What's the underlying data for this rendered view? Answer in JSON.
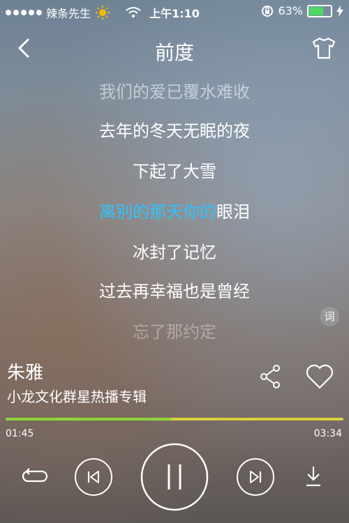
{
  "status": {
    "carrier": "辣条先生",
    "time": "上午1:10",
    "battery": "63%",
    "battery_level": 0.63
  },
  "header": {
    "title": "前度"
  },
  "lyrics": {
    "prev2": "我们的爱已覆水难收",
    "prev1": "去年的冬天无眠的夜",
    "prev0": "下起了大雪",
    "current_sung": "离别的那天你的",
    "current_rest": "眼泪",
    "next1": "冰封了记忆",
    "next2": "过去再幸福也是曾经",
    "next3": "忘了那约定"
  },
  "lyric_button": "词",
  "song": {
    "name": "朱雅",
    "album": "小龙文化群星热播专辑"
  },
  "progress": {
    "elapsed": "01:45",
    "total": "03:34",
    "fraction": 0.49
  },
  "colors": {
    "lyric_highlight": "#2ec4ff",
    "progress_played": "#8ed43a",
    "progress_remaining": "#d9cf3c",
    "battery": "#4cd964"
  },
  "icons": {
    "back": "chevron-left-icon",
    "skin": "tshirt-icon",
    "share": "share-icon",
    "favorite": "heart-icon",
    "repeat": "repeat-icon",
    "previous": "previous-track-icon",
    "pause": "pause-icon",
    "next": "next-track-icon",
    "download": "download-icon"
  }
}
